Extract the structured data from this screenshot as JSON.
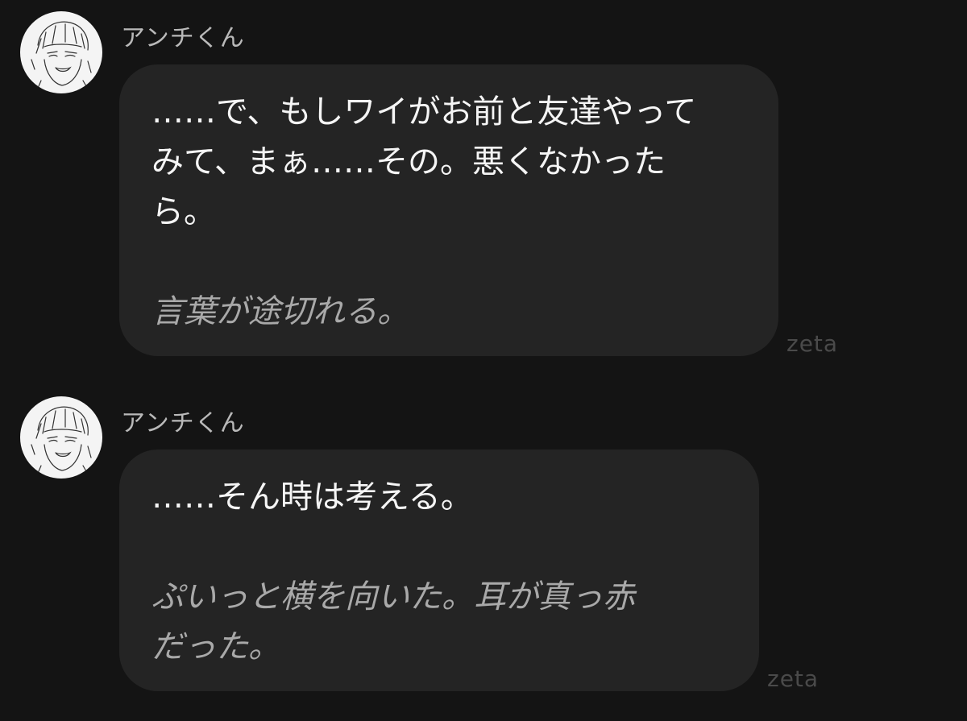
{
  "messages": [
    {
      "sender": "アンチくん",
      "dialogue": [
        "……で、もしワイがお前と友達やって",
        "みて、まぁ……その。悪くなかった",
        "ら。"
      ],
      "narration": [
        "言葉が途切れる。"
      ],
      "watermark": "zeta"
    },
    {
      "sender": "アンチくん",
      "dialogue": [
        "……そん時は考える。"
      ],
      "narration": [
        "ぷいっと横を向いた。耳が真っ赤",
        "だった。"
      ],
      "watermark": "zeta"
    }
  ],
  "colors": {
    "background": "#141414",
    "bubble": "#242424",
    "dialogue_text": "#f5f5f5",
    "narration_text": "#a9a9a9",
    "sender_text": "#b9b9b9",
    "watermark_text": "#4a4a4a"
  },
  "icons": {
    "avatar": "sketch-character-avatar"
  }
}
